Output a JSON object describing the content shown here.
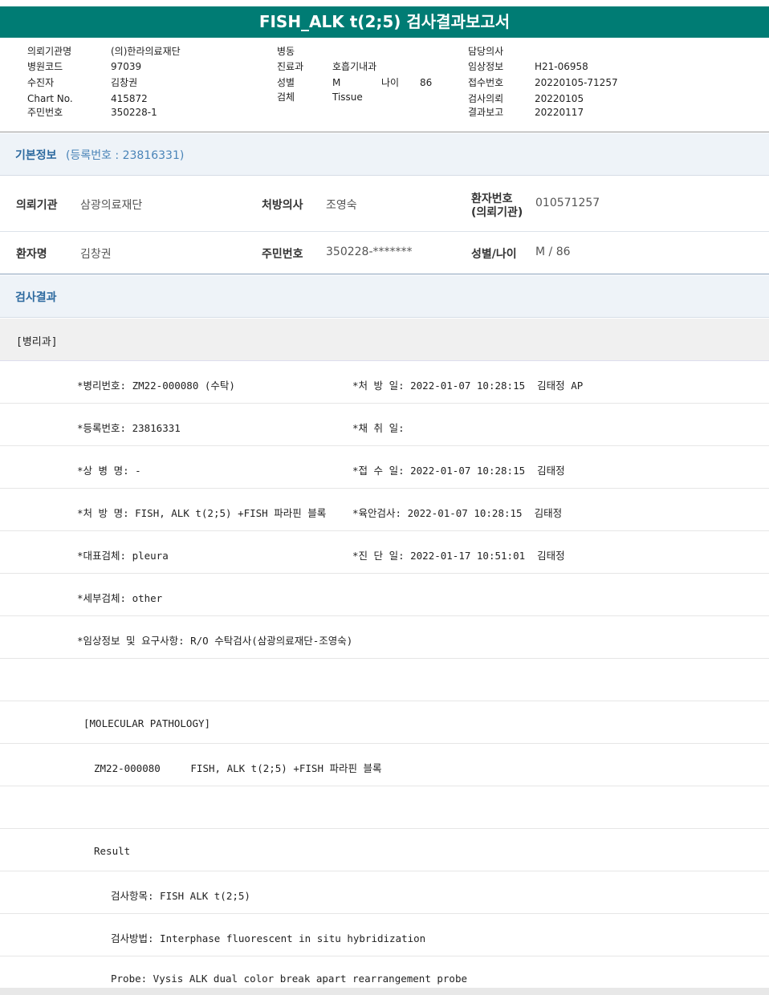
{
  "title": "FISH_ALK t(2;5) 검사결과보고서",
  "header": {
    "col1": [
      {
        "label": "의뢰기관명",
        "value": "(의)한라의료재단"
      },
      {
        "label": "병원코드",
        "value": "97039"
      },
      {
        "label": "수진자",
        "value": "김창권"
      },
      {
        "label": "Chart No.",
        "value": "415872"
      },
      {
        "label": "주민번호",
        "value": "350228-1"
      }
    ],
    "col2": [
      {
        "label": "병동",
        "value": ""
      },
      {
        "label": "진료과",
        "value": "호흡기내과"
      },
      {
        "label": "성별",
        "value": "M"
      },
      {
        "label": "검체",
        "value": "Tissue"
      }
    ],
    "age": {
      "label": "나이",
      "value": "86"
    },
    "col3": [
      {
        "label": "담당의사",
        "value": ""
      },
      {
        "label": "임상정보",
        "value": "H21-06958"
      },
      {
        "label": "접수번호",
        "value": "20220105-71257"
      },
      {
        "label": "검사의뢰",
        "value": "20220105"
      },
      {
        "label": "결과보고",
        "value": "20220117"
      }
    ]
  },
  "basic_info": {
    "section_title": "기본정보",
    "registration": "(등록번호 : 23816331)",
    "referral_label": "의뢰기관",
    "referral_value": "삼광의료재단",
    "doctor_label": "처방의사",
    "doctor_value": "조영숙",
    "patient_no_label_1": "환자번호",
    "patient_no_label_2": "(의뢰기관)",
    "patient_no_value": "010571257",
    "name_label": "환자명",
    "name_value": "김창권",
    "rrn_label": "주민번호",
    "rrn_value": "350228-*******",
    "sex_age_label": "성별/나이",
    "sex_age_value": "M / 86"
  },
  "results": {
    "section_title": "검사결과",
    "dept": "[병리과]",
    "rows": [
      {
        "left": "*병리번호: ZM22-000080 (수탁)",
        "right": "*처 방 일: 2022-01-07 10:28:15  김태정 AP"
      },
      {
        "left": "*등록번호: 23816331",
        "right": "*채 취 일:"
      },
      {
        "left": "*상 병 명: -",
        "right": "*접 수 일: 2022-01-07 10:28:15  김태정"
      },
      {
        "left": "*처 방 명: FISH, ALK t(2;5) +FISH 파라핀 블록",
        "right": "*육안검사: 2022-01-07 10:28:15  김태정"
      },
      {
        "left": "*대표검체: pleura",
        "right": "*진 단 일: 2022-01-17 10:51:01  김태정"
      },
      {
        "left": "*세부검체: other",
        "right": ""
      },
      {
        "left": "*임상정보 및 요구사항: R/O 수탁검사(삼광의료재단-조영숙)",
        "right": ""
      }
    ],
    "molecular_header": "[MOLECULAR PATHOLOGY]",
    "molecular_line": "ZM22-000080     FISH, ALK t(2;5) +FISH 파라핀 블록",
    "result_label": "Result",
    "test_item": "검사항목: FISH ALK t(2;5)",
    "test_method": "검사방법: Interphase fluorescent in situ hybridization",
    "probe": "Probe: Vysis ALK dual color break apart rearrangement probe"
  }
}
